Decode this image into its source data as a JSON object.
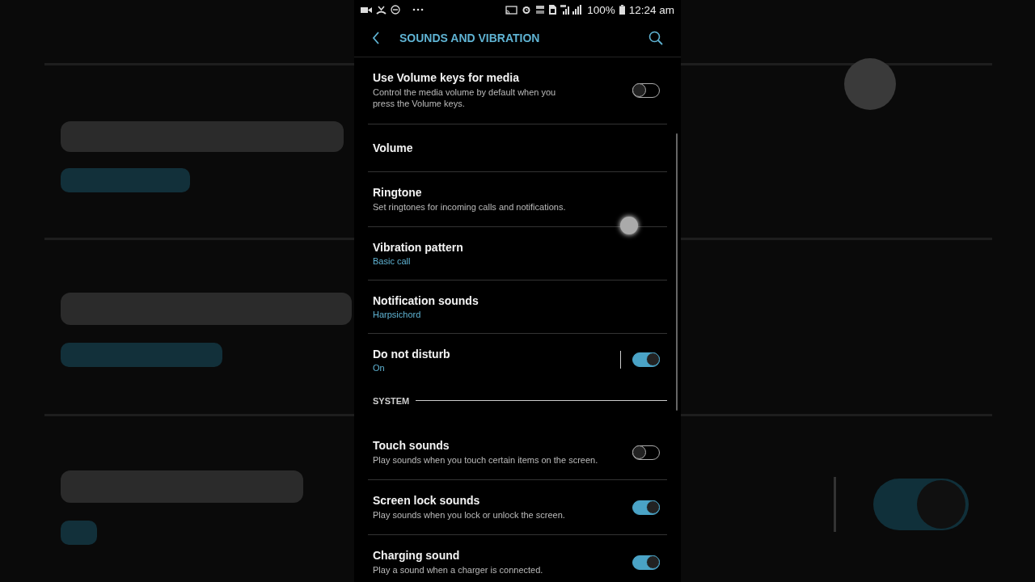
{
  "status_bar": {
    "battery": "100%",
    "time": "12:24 am"
  },
  "header": {
    "title": "SOUNDS AND VIBRATION"
  },
  "items": [
    {
      "kind": "toggle",
      "title": "Use Volume keys for media",
      "summary": "Control the media volume by default when you press the Volume keys.",
      "on": false
    },
    {
      "kind": "setting",
      "title": "Volume"
    },
    {
      "kind": "setting",
      "title": "Ringtone",
      "summary": "Set ringtones for incoming calls and notifications."
    },
    {
      "kind": "setting",
      "title": "Vibration pattern",
      "value": "Basic call"
    },
    {
      "kind": "setting",
      "title": "Notification sounds",
      "value": "Harpsichord"
    },
    {
      "kind": "toggle",
      "title": "Do not disturb",
      "value": "On",
      "on": true,
      "separator": true
    },
    {
      "kind": "header",
      "title": "SYSTEM"
    },
    {
      "kind": "toggle",
      "title": "Touch sounds",
      "summary": "Play sounds when you touch certain items on the screen.",
      "on": false
    },
    {
      "kind": "toggle",
      "title": "Screen lock sounds",
      "summary": "Play sounds when you lock or unlock the screen.",
      "on": true
    },
    {
      "kind": "toggle",
      "title": "Charging sound",
      "summary": "Play a sound when a charger is connected.",
      "on": true
    }
  ]
}
